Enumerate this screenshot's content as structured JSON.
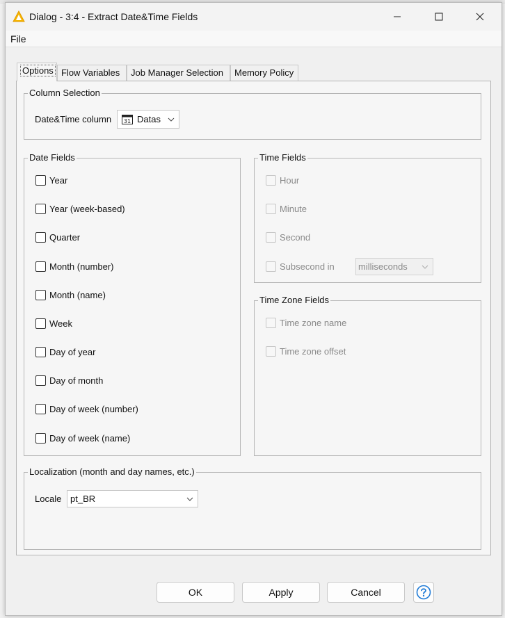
{
  "window": {
    "title": "Dialog - 3:4 - Extract Date&Time Fields",
    "menu": [
      "File"
    ]
  },
  "tabs": [
    "Options",
    "Flow Variables",
    "Job Manager Selection",
    "Memory Policy"
  ],
  "column_selection": {
    "title": "Column Selection",
    "label": "Date&Time column",
    "value": "Datas",
    "icon_text": "31"
  },
  "date_fields": {
    "title": "Date Fields",
    "items": [
      "Year",
      "Year (week-based)",
      "Quarter",
      "Month (number)",
      "Month (name)",
      "Week",
      "Day of year",
      "Day of month",
      "Day of week (number)",
      "Day of week (name)"
    ]
  },
  "time_fields": {
    "title": "Time Fields",
    "items": [
      "Hour",
      "Minute",
      "Second",
      "Subsecond in"
    ],
    "subsecond_unit": "milliseconds"
  },
  "time_zone_fields": {
    "title": "Time Zone Fields",
    "items": [
      "Time zone name",
      "Time zone offset"
    ]
  },
  "localization": {
    "title": "Localization (month and day names, etc.)",
    "label": "Locale",
    "value": "pt_BR"
  },
  "buttons": {
    "ok": "OK",
    "apply": "Apply",
    "cancel": "Cancel"
  },
  "colors": {
    "accent": "#f5a623",
    "help_blue": "#1e7ad6"
  }
}
